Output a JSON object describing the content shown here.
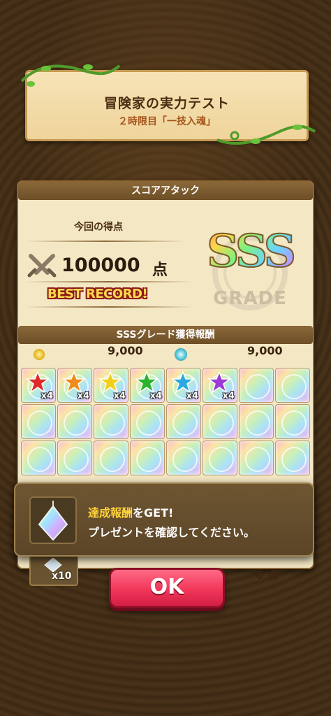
{
  "header": {
    "title": "冒険家の実力テスト",
    "subtitle": "２時限目「一技入魂」"
  },
  "score_panel": {
    "section_title": "スコアアタック",
    "score_label": "今回の得点",
    "score_value": "100000",
    "score_unit": "点",
    "best_record": "BEST RECORD!",
    "grade": "SSS",
    "grade_word": "GRADE"
  },
  "rewards": {
    "section_title": "SSSグレード獲得報酬",
    "currency_1": {
      "icon": "gold-coin-icon",
      "amount": "9,000"
    },
    "currency_2": {
      "icon": "teal-orb-icon",
      "amount": "9,000"
    },
    "gems": [
      {
        "color": "#e02a2a",
        "qty": "x4"
      },
      {
        "color": "#f08a1a",
        "qty": "x4"
      },
      {
        "color": "#f2cf1a",
        "qty": "x4"
      },
      {
        "color": "#2bb32b",
        "qty": "x4"
      },
      {
        "color": "#2aa9e0",
        "qty": "x4"
      },
      {
        "color": "#9b3ad6",
        "qty": "x4"
      }
    ],
    "total_cells": 24
  },
  "popup": {
    "highlight": "達成報酬",
    "line1_rest": "をGET!",
    "line2": "プレゼントを確認してください。"
  },
  "underlay": {
    "item_qty": "x10",
    "points": "0 点"
  },
  "ok_button": "OK"
}
